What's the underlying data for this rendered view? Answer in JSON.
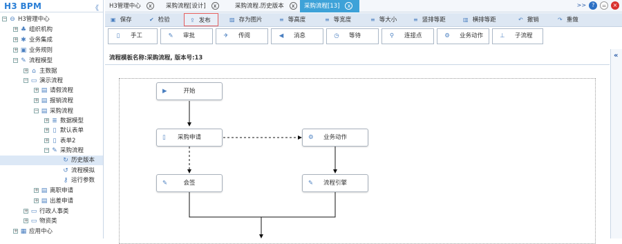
{
  "sidebar": {
    "logo": "H3 BPM",
    "collapse": "《",
    "tree": [
      "H3管理中心",
      "组织机构",
      "业务集成",
      "业务规则",
      "流程模型",
      "主数据",
      "演示流程",
      "请假流程",
      "报销流程",
      "采购流程",
      "数据模型",
      "默认表单",
      "表单2",
      "采购流程",
      "历史版本",
      "流程模拟",
      "运行参数",
      "离职申请",
      "出差申请",
      "行政人事类",
      "物资类",
      "应用中心"
    ]
  },
  "tabs": [
    {
      "label": "H3管理中心"
    },
    {
      "label": "采购流程[设计]"
    },
    {
      "label": "采购流程.历史版本"
    },
    {
      "label": "采购流程[13]"
    }
  ],
  "window_controls": {
    "more": ">>",
    "help": "?",
    "min": "=",
    "close": "×"
  },
  "toolbar": [
    "保存",
    "检验",
    "发布",
    "存为图片",
    "等高度",
    "等宽度",
    "等大小",
    "竖排等距",
    "横排等距",
    "撤销",
    "重做"
  ],
  "node_tools": [
    "手工",
    "审批",
    "传阅",
    "消息",
    "等待",
    "连接点",
    "业务动作",
    "子流程"
  ],
  "template_title": "流程模板名称:采购流程, 版本号:13",
  "right_collapse": "«",
  "flow": {
    "start": "开始",
    "purchase": "采购申请",
    "biz_action": "业务动作",
    "countersign": "会签",
    "engine": "流程引擎"
  }
}
